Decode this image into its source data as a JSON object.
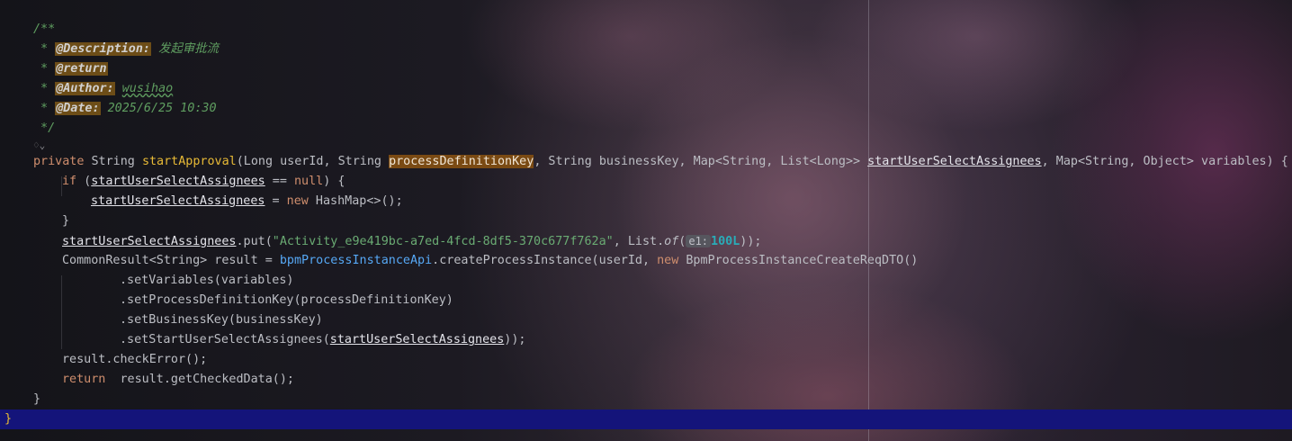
{
  "editor": {
    "doc_open": "/**",
    "doc_desc_prefix": " * ",
    "desc_tag": "@Description:",
    "desc_text": " 发起审批流",
    "return_prefix": " * ",
    "return_tag": "@return",
    "author_prefix": " * ",
    "author_tag": "@Author:",
    "author_space": " ",
    "author_text": "wusihao",
    "date_prefix": " * ",
    "date_tag": "@Date:",
    "date_text": " 2025/6/25 10:30",
    "doc_close": " */",
    "ai_icon": "♢⌄"
  },
  "code": {
    "private": "private",
    "string_type": " String ",
    "method_name": "startApproval",
    "sig_a": "(Long userId, String ",
    "param_pdk": "processDefinitionKey",
    "sig_b": ", String businessKey, Map<String, List<Long>> ",
    "param_susa": "startUserSelectAssignees",
    "sig_c": ", Map<String, Object> variables) {  {",
    "if_kw": "if",
    "if_open": " (",
    "if_field": "startUserSelectAssignees",
    "if_mid": " == ",
    "null_kw": "null",
    "if_close": ") {",
    "assign_field": "startUserSelectAssignees",
    "assign_eq": " = ",
    "new_kw": "new",
    "assign_rest": " HashMap<>();",
    "close_if": "}",
    "put_field": "startUserSelectAssignees",
    "put_call": ".put(",
    "put_str": "\"Activity_e9e419bc-a7ed-4fcd-8df5-370c677f762a\"",
    "put_mid": ", List.",
    "of_fn": "of",
    "put_paren": "(",
    "inlay_hint": "e1:",
    "num_value": "100L",
    "put_end": "));",
    "common_a": "CommonResult<String> result = ",
    "bpm_api": "bpmProcessInstanceApi",
    "common_b": ".createProcessInstance(userId, ",
    "common_new": "new",
    "common_c": " BpmProcessInstanceCreateReqDTO()",
    "set_vars": ".setVariables(variables)",
    "set_pdk": ".setProcessDefinitionKey(processDefinitionKey)",
    "set_bk": ".setBusinessKey(businessKey)",
    "set_susa_a": ".setStartUserSelectAssignees(",
    "set_susa_field": "startUserSelectAssignees",
    "set_susa_end": "));",
    "check_err": "result.checkError();",
    "return_kw": "return",
    "return_rest": "  result.getCheckedData();",
    "method_close": "}",
    "class_close": "}"
  },
  "colors": {
    "keyword": "#cf8e6d",
    "string": "#6aab73",
    "number": "#2aacb8",
    "doc": "#5f9e60",
    "method": "#56a8f5",
    "current_line": "#14147a"
  }
}
